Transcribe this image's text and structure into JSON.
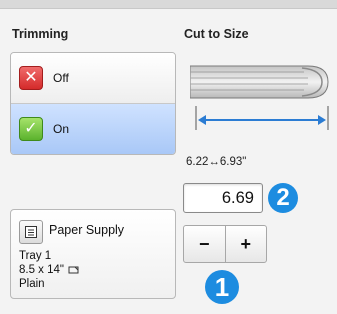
{
  "trimming": {
    "label": "Trimming",
    "options": [
      {
        "label": "Off",
        "icon": "x-icon",
        "selected": false
      },
      {
        "label": "On",
        "icon": "check-icon",
        "selected": true
      }
    ]
  },
  "cut_to_size": {
    "label": "Cut to Size",
    "range_text": "6.22↔6.93\"",
    "value": "6.69",
    "minus_label": "−",
    "plus_label": "+"
  },
  "paper_supply": {
    "button_label": "Paper Supply",
    "tray": "Tray 1",
    "size": "8.5 x 14\"",
    "type": "Plain"
  },
  "callouts": {
    "value_badge": "2",
    "stepper_badge": "1"
  },
  "colors": {
    "selected_bg": "#a9c8f7",
    "badge": "#1d8ce0",
    "arrow": "#2b7cd3"
  }
}
